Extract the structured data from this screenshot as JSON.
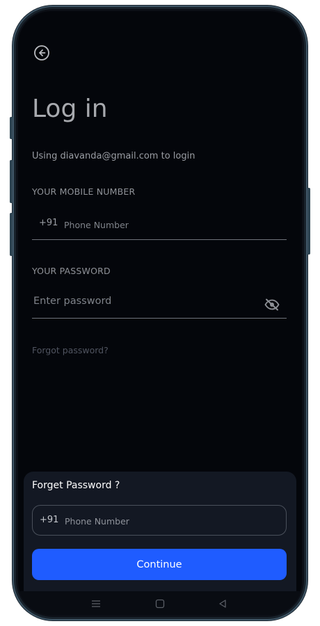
{
  "header": {
    "back_icon": "arrow-left-circle-icon",
    "title": "Log in"
  },
  "login": {
    "subtitle": "Using diavanda@gmail.com to login",
    "mobile_label": "YOUR MOBILE NUMBER",
    "country_code": "+91",
    "phone_placeholder": "Phone Number",
    "password_label": "YOUR PASSWORD",
    "password_placeholder": "Enter password",
    "visibility_icon": "eye-off-icon",
    "forgot_link": "Forgot password?"
  },
  "sheet": {
    "title": "Forget Password ?",
    "country_code": "+91",
    "phone_placeholder": "Phone Number",
    "continue_label": "Continue"
  },
  "navbar": {
    "menu_icon": "menu-icon",
    "home_icon": "square-home-icon",
    "back_icon": "triangle-back-icon"
  },
  "colors": {
    "accent": "#1f5cff",
    "background": "#04060b",
    "sheet": "#131823"
  }
}
